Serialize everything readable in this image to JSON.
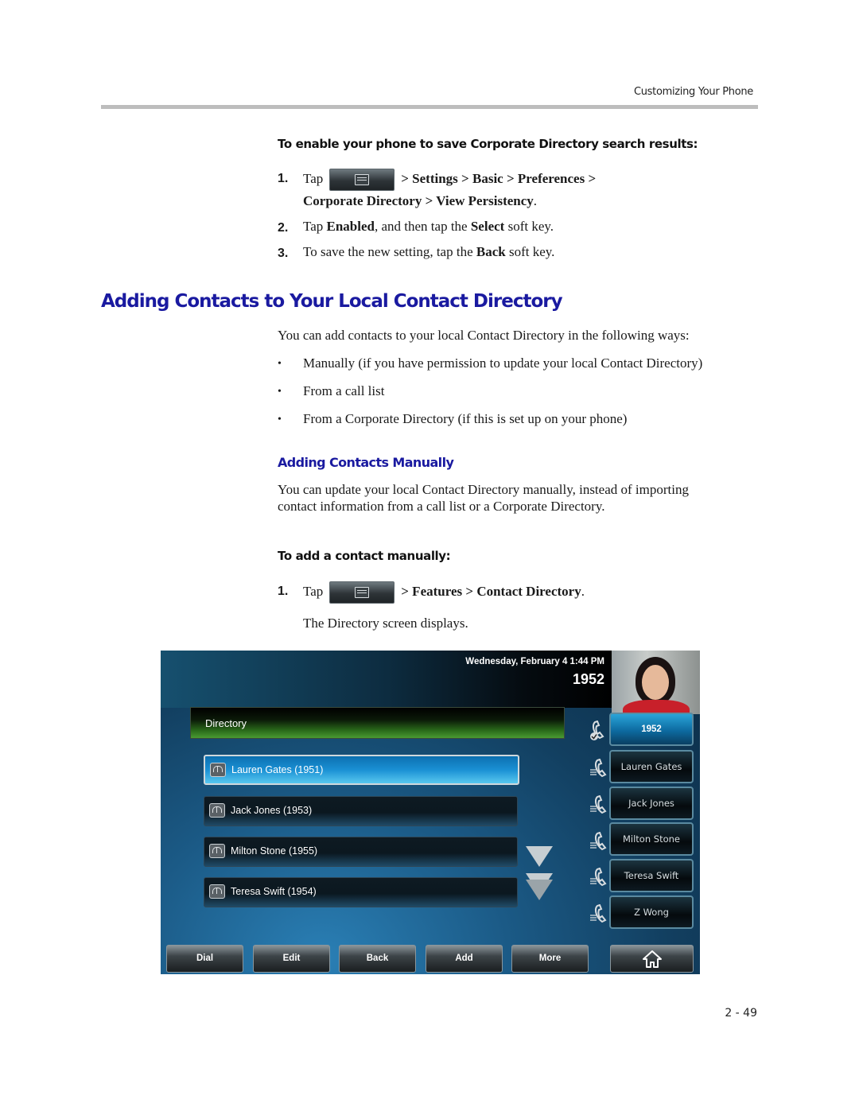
{
  "header": {
    "section_title": "Customizing Your Phone"
  },
  "procedure1": {
    "title": "To enable your phone to save Corporate Directory search results:",
    "steps": [
      {
        "num": "1.",
        "pre": "Tap",
        "icon": "menu-key-icon",
        "path_line1": "> Settings > Basic > Preferences >",
        "path_line2": "Corporate Directory > View Persistency",
        "post": "."
      },
      {
        "num": "2.",
        "parts": [
          "Tap ",
          "Enabled",
          ", and then tap the ",
          "Select",
          " soft key."
        ]
      },
      {
        "num": "3.",
        "parts": [
          "To save the new setting, tap the ",
          "Back",
          " soft key."
        ]
      }
    ]
  },
  "section": {
    "heading": "Adding Contacts to Your Local Contact Directory",
    "intro": "You can add contacts to your local Contact Directory in the following ways:",
    "bullets": [
      "Manually (if you have permission to update your local Contact Directory)",
      "From a call list",
      "From a Corporate Directory (if this is set up on your phone)"
    ],
    "bullet_glyph": "•"
  },
  "subsection": {
    "heading": "Adding Contacts Manually",
    "para_line1": "You can update your local Contact Directory manually, instead of importing",
    "para_line2": "contact information from a call list or a Corporate Directory."
  },
  "procedure2": {
    "title": "To add a contact manually:",
    "step1": {
      "num": "1.",
      "pre": "Tap",
      "path": "> Features > Contact Directory",
      "post": "."
    },
    "result": "The Directory screen displays."
  },
  "phone_screen": {
    "datetime": "Wednesday, February 4  1:44 PM",
    "extension": "1952",
    "screen_title": "Directory",
    "contacts": [
      {
        "label": "Lauren Gates (1951)",
        "selected": true
      },
      {
        "label": "Jack Jones (1953)",
        "selected": false
      },
      {
        "label": "Milton Stone (1955)",
        "selected": false
      },
      {
        "label": "Teresa Swift (1954)",
        "selected": false
      }
    ],
    "line_keys": [
      {
        "label": "1952",
        "active": true
      },
      {
        "label": "Lauren Gates",
        "active": false
      },
      {
        "label": "Jack Jones",
        "active": false
      },
      {
        "label": "Milton Stone",
        "active": false
      },
      {
        "label": "Teresa Swift",
        "active": false
      },
      {
        "label": "Z Wong",
        "active": false
      }
    ],
    "softkeys": [
      "Dial",
      "Edit",
      "Back",
      "Add",
      "More"
    ],
    "home_icon": "home-icon",
    "colors": {
      "selected_row": "#1a90d4",
      "title_bar_green": "#4a9a32",
      "active_line": "#2aa4d8"
    }
  },
  "footer": {
    "page_number": "2 - 49"
  }
}
